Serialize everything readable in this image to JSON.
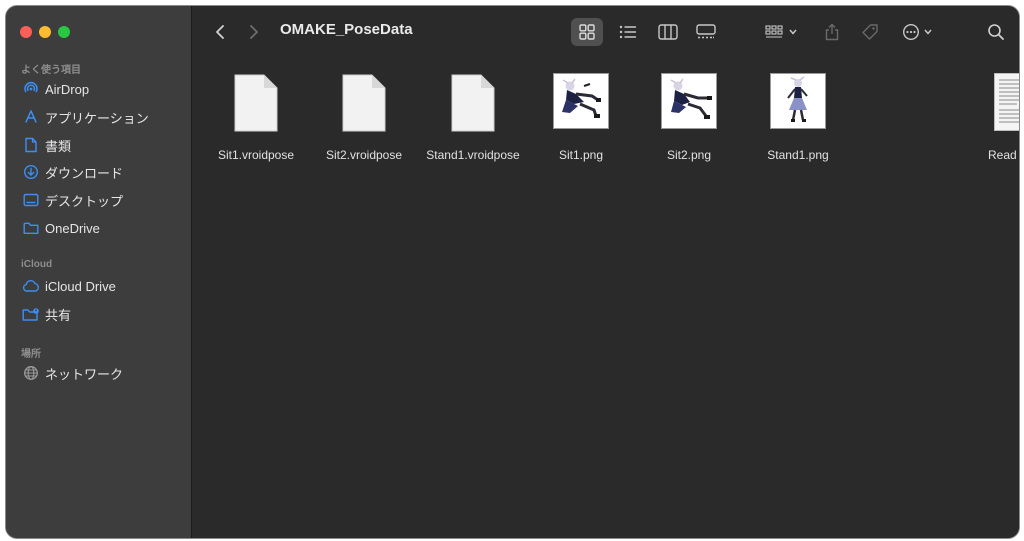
{
  "window": {
    "title": "OMAKE_PoseData"
  },
  "sidebar": {
    "sections": [
      {
        "header": "よく使う項目",
        "items": [
          {
            "label": "AirDrop",
            "icon": "airdrop-icon"
          },
          {
            "label": "アプリケーション",
            "icon": "applications-icon"
          },
          {
            "label": "書類",
            "icon": "document-icon"
          },
          {
            "label": "ダウンロード",
            "icon": "download-icon"
          },
          {
            "label": "デスクトップ",
            "icon": "desktop-icon"
          },
          {
            "label": "OneDrive",
            "icon": "folder-icon"
          }
        ]
      },
      {
        "header": "iCloud",
        "items": [
          {
            "label": "iCloud Drive",
            "icon": "cloud-icon"
          },
          {
            "label": "共有",
            "icon": "shared-folder-icon"
          }
        ]
      },
      {
        "header": "場所",
        "items": [
          {
            "label": "ネットワーク",
            "icon": "globe-icon"
          }
        ]
      }
    ]
  },
  "files": [
    {
      "name": "Sit1.vroidpose",
      "kind": "document"
    },
    {
      "name": "Sit2.vroidpose",
      "kind": "document"
    },
    {
      "name": "Stand1.vroidpose",
      "kind": "document"
    },
    {
      "name": "Sit1.png",
      "kind": "image"
    },
    {
      "name": "Sit2.png",
      "kind": "image"
    },
    {
      "name": "Stand1.png",
      "kind": "image"
    },
    {
      "name": "Read",
      "kind": "text-document-partial"
    }
  ],
  "colors": {
    "sidebar_bg": "#3d3d3d",
    "content_bg": "#2a2a2a",
    "accent": "#3b8ff5",
    "close": "#ff5f57",
    "minimize": "#febc2e",
    "maximize": "#28c840"
  }
}
